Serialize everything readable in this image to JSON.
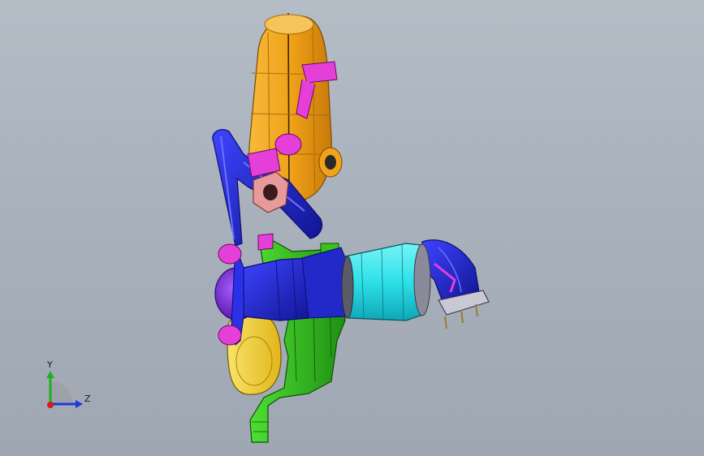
{
  "viewport": {
    "view_name": "cad-3d-viewport",
    "background_top": "#b4bcc6",
    "background_bottom": "#9ea7b2"
  },
  "model": {
    "parts": [
      {
        "name": "muffler-shell-upper",
        "color": "#f0a21a"
      },
      {
        "name": "muffler-shell-lower",
        "color": "#f2cf2e"
      },
      {
        "name": "exhaust-pipe",
        "color": "#1f22d6"
      },
      {
        "name": "catalytic-converter",
        "color": "#2ee0e8"
      },
      {
        "name": "mounting-bracket",
        "color": "#38c21b"
      },
      {
        "name": "flange-clamps",
        "color": "#e53fd9"
      },
      {
        "name": "gasket-plate",
        "color": "#e79a9a"
      },
      {
        "name": "resonator-disk",
        "color": "#7a1fd6"
      }
    ]
  },
  "triad": {
    "y_label": "Y",
    "z_label": "Z",
    "y_color": "#1bb31b",
    "z_color": "#1c3bd6",
    "origin_color": "#d61c1c"
  }
}
